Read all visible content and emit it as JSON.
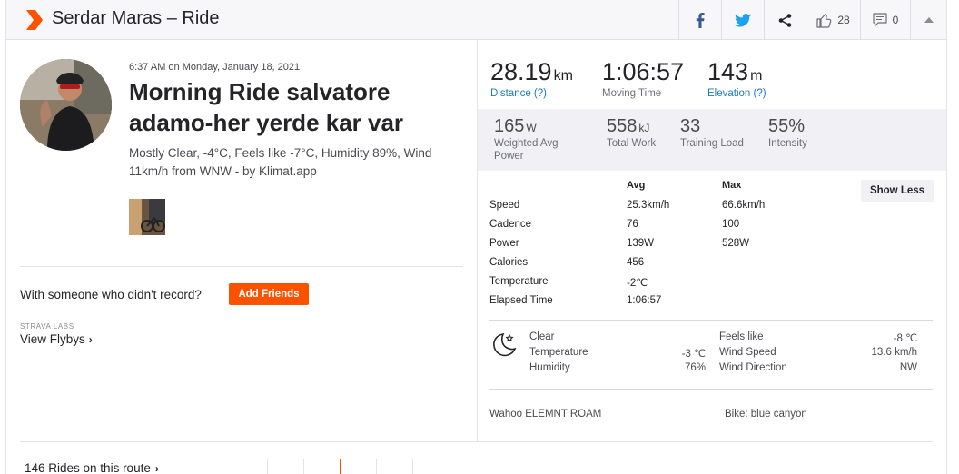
{
  "header": {
    "title": "Serdar Maras – Ride",
    "kudos_count": "28",
    "comment_count": "0",
    "icons": [
      "strava-logo-icon",
      "facebook-icon",
      "twitter-icon",
      "share-icon",
      "thumbs-up-icon",
      "comment-icon",
      "chevron-up-icon"
    ]
  },
  "activity": {
    "date": "6:37 AM on Monday, January 18, 2021",
    "name": "Morning Ride salvatore adamo-her yerde kar var",
    "description": "Mostly Clear, -4°C, Feels like -7°C, Humidity 89%, Wind 11km/h from WNW - by Klimat.app"
  },
  "social": {
    "with_someone": "With someone who didn't record?",
    "add_friends": "Add Friends",
    "labs_label": "STRAVA LABS",
    "view_flybys": "View Flybys"
  },
  "route": {
    "rides_on_route": "146 Rides on this route"
  },
  "primary_stats": [
    {
      "value": "28.19",
      "unit": "km",
      "label": "Distance (?)"
    },
    {
      "value": "1:06:57",
      "unit": "",
      "label": "Moving Time"
    },
    {
      "value": "143",
      "unit": "m",
      "label": "Elevation (?)"
    }
  ],
  "secondary_stats": [
    {
      "value": "165",
      "unit": "W",
      "label": "Weighted Avg Power"
    },
    {
      "value": "558",
      "unit": "kJ",
      "label": "Total Work"
    },
    {
      "value": "33",
      "unit": "",
      "label": "Training Load"
    },
    {
      "value": "55%",
      "unit": "",
      "label": "Intensity"
    }
  ],
  "stats_table": {
    "headers": {
      "avg": "Avg",
      "max": "Max"
    },
    "show_less": "Show Less",
    "rows": [
      {
        "label": "Speed",
        "avg": "25.3km/h",
        "max": "66.6km/h"
      },
      {
        "label": "Cadence",
        "avg": "76",
        "max": "100"
      },
      {
        "label": "Power",
        "avg": "139W",
        "max": "528W"
      },
      {
        "label": "Calories",
        "avg": "456",
        "max": ""
      },
      {
        "label": "Temperature",
        "avg": "-2℃",
        "max": ""
      },
      {
        "label": "Elapsed Time",
        "avg": "1:06:57",
        "max": ""
      }
    ]
  },
  "weather": {
    "icon": "moon-stars-icon",
    "condition": "Clear",
    "temperature_label": "Temperature",
    "temperature_value": "-3 ℃",
    "humidity_label": "Humidity",
    "humidity_value": "76%",
    "feels_like_label": "Feels like",
    "feels_like_value": "-8 ℃",
    "wind_speed_label": "Wind Speed",
    "wind_speed_value": "13.6 km/h",
    "wind_direction_label": "Wind Direction",
    "wind_direction_value": "NW"
  },
  "equipment": {
    "device": "Wahoo ELEMNT ROAM",
    "bike": "Bike: blue canyon"
  },
  "colors": {
    "brand": "#fc5200",
    "link": "#1a7bbf",
    "facebook": "#3b5998",
    "twitter": "#1da1f2"
  }
}
